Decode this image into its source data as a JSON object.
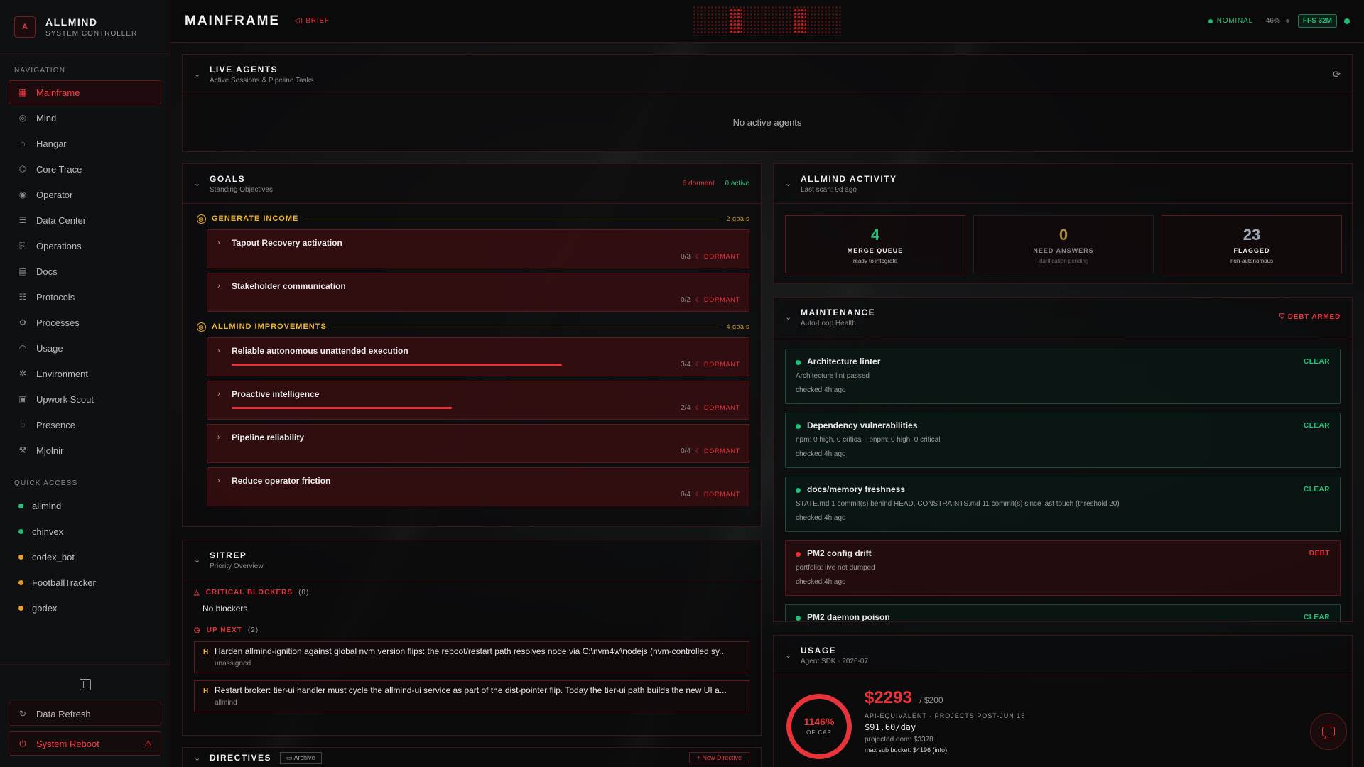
{
  "brand": {
    "logo": "A",
    "title": "ALLMIND",
    "subtitle": "SYSTEM CONTROLLER"
  },
  "nav": {
    "label": "NAVIGATION",
    "items": [
      {
        "label": "Mainframe",
        "icon": "grid-icon"
      },
      {
        "label": "Mind",
        "icon": "brain-icon"
      },
      {
        "label": "Hangar",
        "icon": "hangar-icon"
      },
      {
        "label": "Core Trace",
        "icon": "trace-icon"
      },
      {
        "label": "Operator",
        "icon": "operator-icon"
      },
      {
        "label": "Data Center",
        "icon": "database-icon"
      },
      {
        "label": "Operations",
        "icon": "operations-icon"
      },
      {
        "label": "Docs",
        "icon": "docs-icon"
      },
      {
        "label": "Protocols",
        "icon": "protocols-icon"
      },
      {
        "label": "Processes",
        "icon": "gear-icon"
      },
      {
        "label": "Usage",
        "icon": "gauge-icon"
      },
      {
        "label": "Environment",
        "icon": "settings-icon"
      },
      {
        "label": "Upwork Scout",
        "icon": "briefcase-icon"
      },
      {
        "label": "Presence",
        "icon": "radio-icon"
      },
      {
        "label": "Mjolnir",
        "icon": "hammer-icon"
      }
    ]
  },
  "quick_access": {
    "label": "QUICK ACCESS",
    "items": [
      {
        "label": "allmind",
        "color": "#22c07a"
      },
      {
        "label": "chinvex",
        "color": "#22c07a"
      },
      {
        "label": "codex_bot",
        "color": "#f0a020"
      },
      {
        "label": "FootballTracker",
        "color": "#f0a020"
      },
      {
        "label": "godex",
        "color": "#f0a020"
      }
    ]
  },
  "sidebar_bottom": {
    "refresh": "Data Refresh",
    "reboot": "System Reboot"
  },
  "header": {
    "title": "MAINFRAME",
    "brief": "BRIEF",
    "status": "NOMINAL",
    "pct": "46%",
    "ffs": "FFS 32M"
  },
  "live_agents": {
    "title": "LIVE AGENTS",
    "subtitle": "Active Sessions & Pipeline Tasks",
    "empty": "No active agents"
  },
  "goals": {
    "title": "GOALS",
    "subtitle": "Standing Objectives",
    "dormant": "6 dormant",
    "active": "0 active",
    "groups": [
      {
        "name": "GENERATE INCOME",
        "count": "2 goals",
        "items": [
          {
            "title": "Tapout Recovery activation",
            "progress": "0/3",
            "state": "DORMANT",
            "fraction": 0
          },
          {
            "title": "Stakeholder communication",
            "progress": "0/2",
            "state": "DORMANT",
            "fraction": 0
          }
        ]
      },
      {
        "name": "ALLMIND IMPROVEMENTS",
        "count": "4 goals",
        "items": [
          {
            "title": "Reliable autonomous unattended execution",
            "progress": "3/4",
            "state": "DORMANT",
            "fraction": 0.75
          },
          {
            "title": "Proactive intelligence",
            "progress": "2/4",
            "state": "DORMANT",
            "fraction": 0.5
          },
          {
            "title": "Pipeline reliability",
            "progress": "0/4",
            "state": "DORMANT",
            "fraction": 0
          },
          {
            "title": "Reduce operator friction",
            "progress": "0/4",
            "state": "DORMANT",
            "fraction": 0
          }
        ]
      }
    ]
  },
  "sitrep": {
    "title": "SITREP",
    "subtitle": "Priority Overview",
    "blockers_label": "CRITICAL BLOCKERS",
    "blockers_count": "(0)",
    "no_blockers": "No blockers",
    "upnext_label": "UP NEXT",
    "upnext_count": "(2)",
    "items": [
      {
        "priority": "H",
        "text": "Harden allmind-ignition against global nvm version flips: the reboot/restart path resolves node via C:\\nvm4w\\nodejs (nvm-controlled sy...",
        "owner": "unassigned"
      },
      {
        "priority": "H",
        "text": "Restart broker: tier-ui handler must cycle the allmind-ui service as part of the dist-pointer flip. Today the tier-ui path builds the new UI a...",
        "owner": "allmind"
      }
    ]
  },
  "directives": {
    "title": "DIRECTIVES",
    "archive": "Archive",
    "new": "+ New Directive"
  },
  "activity": {
    "title": "ALLMIND ACTIVITY",
    "subtitle": "Last scan: 9d ago",
    "stats": [
      {
        "num": "4",
        "label": "MERGE QUEUE",
        "sub": "ready to integrate",
        "color": "#22c07a"
      },
      {
        "num": "0",
        "label": "NEED ANSWERS",
        "sub": "clarification pending",
        "color": "#a88a3a"
      },
      {
        "num": "23",
        "label": "FLAGGED",
        "sub": "non-autonomous",
        "color": "#9aa8b8"
      }
    ]
  },
  "maintenance": {
    "title": "MAINTENANCE",
    "subtitle": "Auto-Loop Health",
    "badge": "DEBT ARMED",
    "cards": [
      {
        "title": "Architecture linter",
        "desc": "Architecture lint passed",
        "checked": "checked 4h ago",
        "state": "CLEAR",
        "debt": false
      },
      {
        "title": "Dependency vulnerabilities",
        "desc": "npm: 0 high, 0 critical · pnpm: 0 high, 0 critical",
        "checked": "checked 4h ago",
        "state": "CLEAR",
        "debt": false
      },
      {
        "title": "docs/memory freshness",
        "desc": "STATE.md 1 commit(s) behind HEAD, CONSTRAINTS.md 11 commit(s) since last touch (threshold 20)",
        "checked": "checked 4h ago",
        "state": "CLEAR",
        "debt": false
      },
      {
        "title": "PM2 config drift",
        "desc": "portfolio: live not dumped",
        "checked": "checked 4h ago",
        "state": "DEBT",
        "debt": true
      },
      {
        "title": "PM2 daemon poison",
        "desc": "",
        "checked": "",
        "state": "CLEAR",
        "debt": false
      }
    ]
  },
  "usage": {
    "title": "USAGE",
    "subtitle": "Agent SDK · 2026-07",
    "gauge_pct": "1146%",
    "gauge_label": "OF CAP",
    "amount": "$2293",
    "cap": "/ $200",
    "note": "API-EQUIVALENT · PROJECTS POST-JUN 15",
    "per_day": "$91.60/day",
    "projected": "projected eom: $3378",
    "bucket": "max sub bucket: $4196 (info)"
  }
}
